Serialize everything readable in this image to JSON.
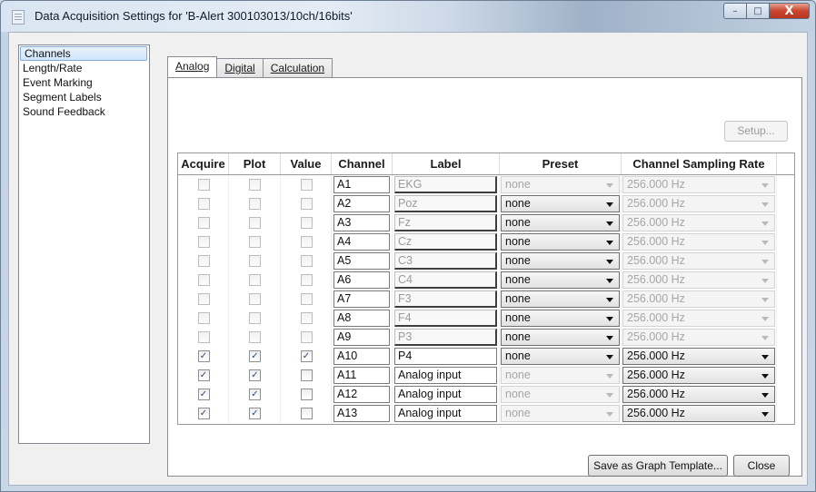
{
  "window": {
    "title": "Data Acquisition Settings for 'B-Alert 300103013/10ch/16bits'",
    "minimize_symbol": "–",
    "maximize_symbol": "□",
    "close_symbol": "X"
  },
  "sidebar": {
    "items": [
      {
        "label": "Channels",
        "selected": true
      },
      {
        "label": "Length/Rate",
        "selected": false
      },
      {
        "label": "Event Marking",
        "selected": false
      },
      {
        "label": "Segment Labels",
        "selected": false
      },
      {
        "label": "Sound Feedback",
        "selected": false
      }
    ]
  },
  "tabs": [
    {
      "label": "Analog",
      "active": true
    },
    {
      "label": "Digital",
      "active": false
    },
    {
      "label": "Calculation",
      "active": false
    }
  ],
  "setup_button": "Setup...",
  "grid": {
    "columns": [
      "Acquire",
      "Plot",
      "Value",
      "Channel",
      "Label",
      "Preset",
      "Channel Sampling Rate"
    ],
    "rows": [
      {
        "acquire": false,
        "plot": false,
        "value": false,
        "channel": "A1",
        "label": "EKG",
        "preset": "none",
        "preset_enabled": false,
        "rate": "256.000 Hz",
        "rate_enabled": false
      },
      {
        "acquire": false,
        "plot": false,
        "value": false,
        "channel": "A2",
        "label": "Poz",
        "preset": "none",
        "preset_enabled": true,
        "rate": "256.000 Hz",
        "rate_enabled": false
      },
      {
        "acquire": false,
        "plot": false,
        "value": false,
        "channel": "A3",
        "label": "Fz",
        "preset": "none",
        "preset_enabled": true,
        "rate": "256.000 Hz",
        "rate_enabled": false
      },
      {
        "acquire": false,
        "plot": false,
        "value": false,
        "channel": "A4",
        "label": "Cz",
        "preset": "none",
        "preset_enabled": true,
        "rate": "256.000 Hz",
        "rate_enabled": false
      },
      {
        "acquire": false,
        "plot": false,
        "value": false,
        "channel": "A5",
        "label": "C3",
        "preset": "none",
        "preset_enabled": true,
        "rate": "256.000 Hz",
        "rate_enabled": false
      },
      {
        "acquire": false,
        "plot": false,
        "value": false,
        "channel": "A6",
        "label": "C4",
        "preset": "none",
        "preset_enabled": true,
        "rate": "256.000 Hz",
        "rate_enabled": false
      },
      {
        "acquire": false,
        "plot": false,
        "value": false,
        "channel": "A7",
        "label": "F3",
        "preset": "none",
        "preset_enabled": true,
        "rate": "256.000 Hz",
        "rate_enabled": false
      },
      {
        "acquire": false,
        "plot": false,
        "value": false,
        "channel": "A8",
        "label": "F4",
        "preset": "none",
        "preset_enabled": true,
        "rate": "256.000 Hz",
        "rate_enabled": false
      },
      {
        "acquire": false,
        "plot": false,
        "value": false,
        "channel": "A9",
        "label": "P3",
        "preset": "none",
        "preset_enabled": true,
        "rate": "256.000 Hz",
        "rate_enabled": false
      },
      {
        "acquire": true,
        "plot": true,
        "value": true,
        "channel": "A10",
        "label": "P4",
        "preset": "none",
        "preset_enabled": true,
        "rate": "256.000 Hz",
        "rate_enabled": true
      },
      {
        "acquire": true,
        "plot": true,
        "value": false,
        "channel": "A11",
        "label": "Analog input",
        "preset": "none",
        "preset_enabled": false,
        "rate": "256.000 Hz",
        "rate_enabled": true
      },
      {
        "acquire": true,
        "plot": true,
        "value": false,
        "channel": "A12",
        "label": "Analog input",
        "preset": "none",
        "preset_enabled": false,
        "rate": "256.000 Hz",
        "rate_enabled": true
      },
      {
        "acquire": true,
        "plot": true,
        "value": false,
        "channel": "A13",
        "label": "Analog input",
        "preset": "none",
        "preset_enabled": false,
        "rate": "256.000 Hz",
        "rate_enabled": true
      }
    ]
  },
  "buttons": {
    "save_template": "Save as Graph Template...",
    "close": "Close"
  }
}
